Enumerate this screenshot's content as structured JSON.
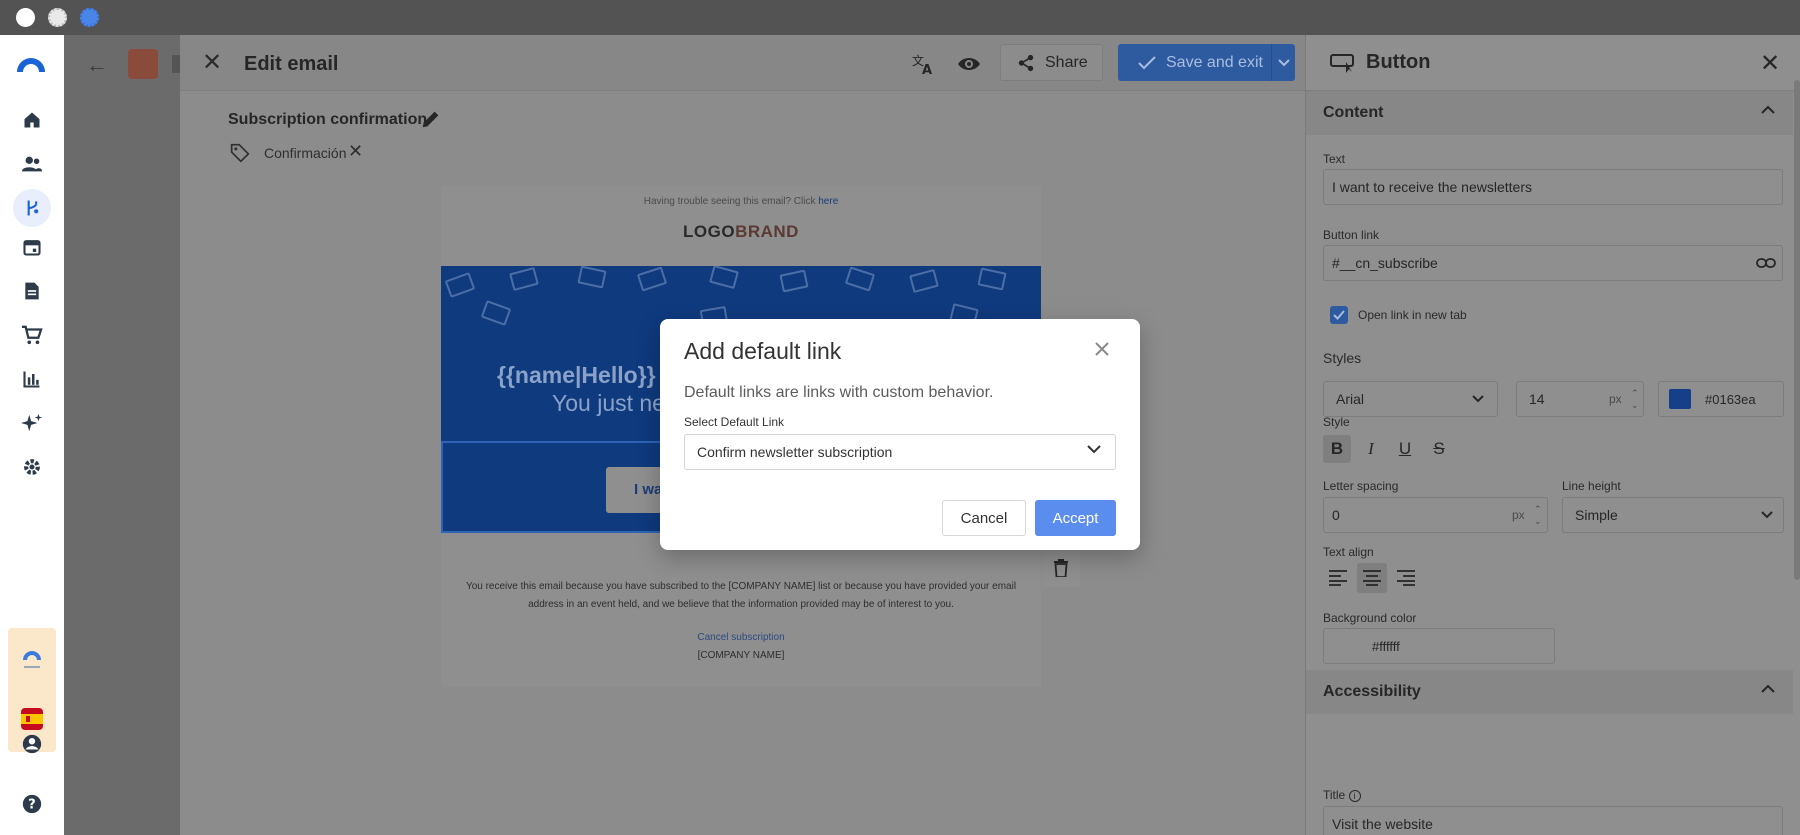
{
  "colors": {
    "accent": "#5b8def",
    "brand_blue": "#0163ea",
    "overlay": "#8c8c8c"
  },
  "editor": {
    "title": "Edit email",
    "share_label": "Share",
    "save_label": "Save and exit",
    "subject": "Subscription confirmation",
    "tag": "Confirmación"
  },
  "email": {
    "trouble_text": "Having trouble seeing this email? Click",
    "trouble_link": "here",
    "logo_part1": "LOGO",
    "logo_part2": "BRAND",
    "greeting": "{{name|Hello}}",
    "subline": "You just ne",
    "button_text": "I wa",
    "footer_text": "You receive this email because you have subscribed to the [COMPANY NAME] list or because you have provided your email address in an event held, and we believe that the information provided may be of interest to you.",
    "cancel_subscription": "Cancel subscription",
    "company": "[COMPANY NAME]"
  },
  "panel": {
    "title": "Button",
    "content_section": "Content",
    "text_label": "Text",
    "text_value": "I want to receive the newsletters",
    "link_label": "Button link",
    "link_value": "#__cn_subscribe",
    "open_new_tab": "Open link in new tab",
    "styles_label": "Styles",
    "font_family": "Arial",
    "font_size": "14",
    "font_unit": "px",
    "color_value": "#0163ea",
    "style_label": "Style",
    "letter_spacing_label": "Letter spacing",
    "letter_spacing_value": "0",
    "letter_spacing_unit": "px",
    "line_height_label": "Line height",
    "line_height_value": "Simple",
    "text_align_label": "Text align",
    "bg_color_label": "Background color",
    "bg_color_value": "#ffffff",
    "accessibility_section": "Accessibility",
    "title_label": "Title",
    "title_value": "Visit the website"
  },
  "modal": {
    "title": "Add default link",
    "description": "Default links are links with custom behavior.",
    "select_label": "Select Default Link",
    "select_value": "Confirm newsletter subscription",
    "cancel_label": "Cancel",
    "accept_label": "Accept"
  }
}
